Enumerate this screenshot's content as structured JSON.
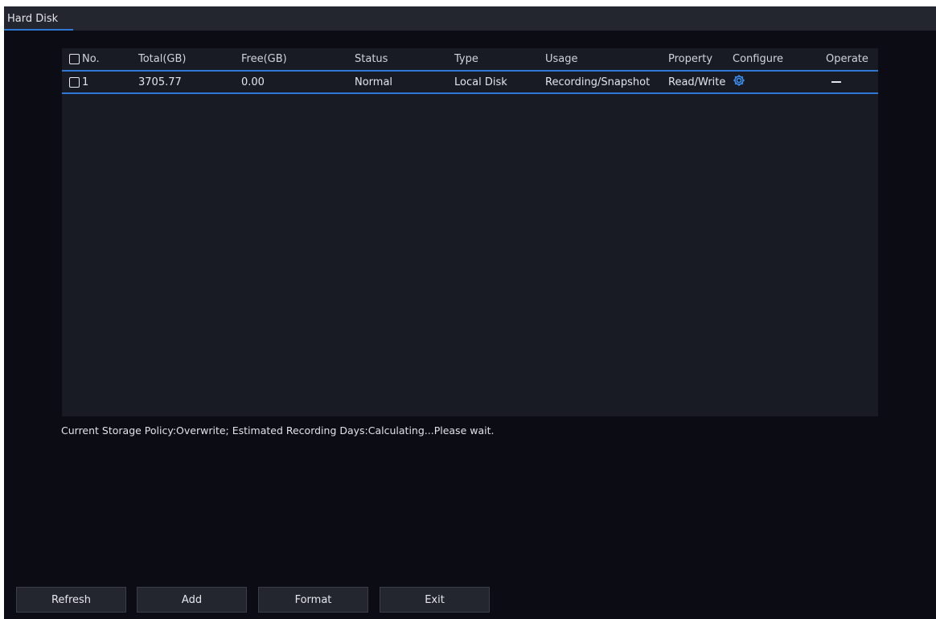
{
  "window": {
    "tab_label": "Hard Disk"
  },
  "table": {
    "columns": [
      "No.",
      "Total(GB)",
      "Free(GB)",
      "Status",
      "Type",
      "Usage",
      "Property",
      "Configure",
      "Operate"
    ],
    "rows": [
      {
        "no": "1",
        "total": "3705.77",
        "free": "0.00",
        "status": "Normal",
        "type": "Local Disk",
        "usage": "Recording/Snapshot",
        "property": "Read/Write",
        "configure_icon": "gear-icon",
        "operate": "—"
      }
    ]
  },
  "policy_text": "Current Storage Policy:Overwrite; Estimated Recording Days:Calculating...Please wait.",
  "buttons": {
    "refresh": "Refresh",
    "add": "Add",
    "format": "Format",
    "exit": "Exit"
  },
  "colors": {
    "accent": "#2f79d6",
    "background": "#0b0c14",
    "panel": "#181b24",
    "gear": "#3d8ef0"
  }
}
